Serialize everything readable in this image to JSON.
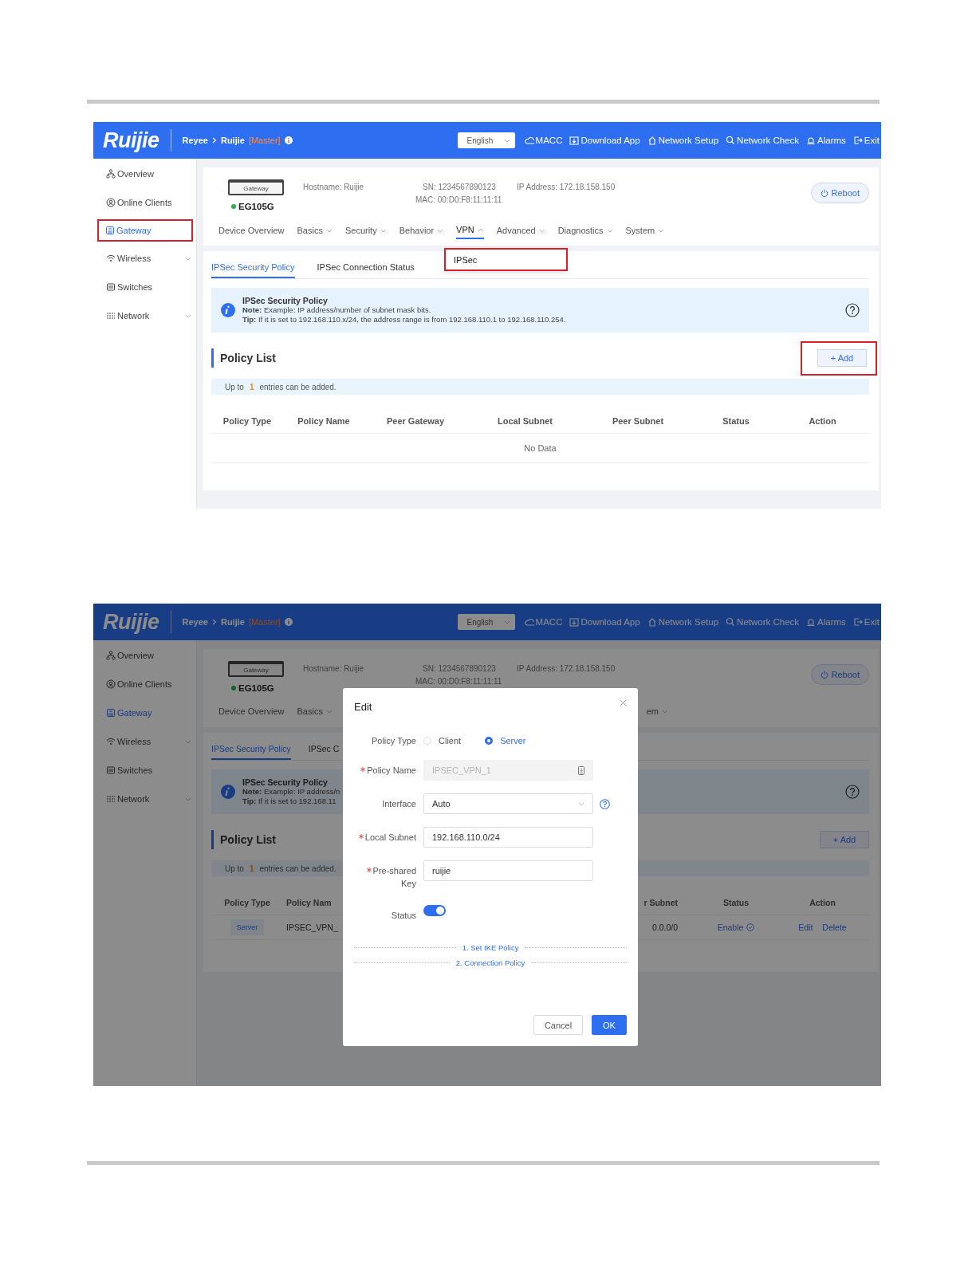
{
  "screens": [
    {
      "dimmed": false,
      "header": {
        "logo": "Ruijie",
        "breadcrumb": [
          "Reyee",
          "Ruijie"
        ],
        "role": "[Master]",
        "language": "English",
        "actions": [
          {
            "kind": "cloud",
            "label": "MACC"
          },
          {
            "kind": "download",
            "label": "Download App"
          },
          {
            "kind": "setup",
            "label": "Network Setup"
          },
          {
            "kind": "check",
            "label": "Network Check"
          },
          {
            "kind": "alarm",
            "label": "Alarms"
          },
          {
            "kind": "exit",
            "label": "Exit"
          }
        ]
      },
      "sidebar": [
        {
          "kind": "overview",
          "label": "Overview",
          "selected": false,
          "expandable": false,
          "annotated": false
        },
        {
          "kind": "clients",
          "label": "Online Clients",
          "selected": false,
          "expandable": false,
          "annotated": false
        },
        {
          "kind": "gateway",
          "label": "Gateway",
          "selected": true,
          "expandable": false,
          "annotated": true
        },
        {
          "kind": "wireless",
          "label": "Wireless",
          "selected": false,
          "expandable": true,
          "annotated": false
        },
        {
          "kind": "switches",
          "label": "Switches",
          "selected": false,
          "expandable": false,
          "annotated": false
        },
        {
          "kind": "network",
          "label": "Network",
          "selected": false,
          "expandable": true,
          "annotated": false
        }
      ],
      "device": {
        "icon_label": "Gateway",
        "model": "EG105G",
        "online": true,
        "hostname_label": "Hostname:",
        "hostname": "Ruijie",
        "sn_label": "SN:",
        "sn": "1234567890123",
        "mac_label": "MAC:",
        "mac": "00:D0:F8:11:11:11",
        "ip_label": "IP Address:",
        "ip": "172.18.158.150",
        "reboot": "Reboot"
      },
      "nav": [
        {
          "label": "Device Overview",
          "dropdown": false,
          "expanded": false,
          "selected": false
        },
        {
          "label": "Basics",
          "dropdown": true,
          "expanded": false,
          "selected": false
        },
        {
          "label": "Security",
          "dropdown": true,
          "expanded": false,
          "selected": false
        },
        {
          "label": "Behavior",
          "dropdown": true,
          "expanded": false,
          "selected": false
        },
        {
          "label": "VPN",
          "dropdown": true,
          "expanded": true,
          "selected": true
        },
        {
          "label": "Advanced",
          "dropdown": true,
          "expanded": false,
          "selected": false
        },
        {
          "label": "Diagnostics",
          "dropdown": true,
          "expanded": false,
          "selected": false
        },
        {
          "label": "System",
          "dropdown": true,
          "expanded": false,
          "selected": false
        }
      ],
      "submenu": {
        "items": [
          "IPSec"
        ],
        "annotated": true
      },
      "sub_tabs": [
        {
          "label": "IPSec Security Policy",
          "selected": true
        },
        {
          "label": "IPSec Connection Status",
          "selected": false
        }
      ],
      "info": {
        "title": "IPSec Security Policy",
        "note": "**Note:** Example: IP address/number of subnet mask bits.",
        "tip": "**Tip:** If it is set to 192.168.110.x/24, the address range is from 192.168.110.1 to 192.168.110.254."
      },
      "policy_list": {
        "title": "Policy List",
        "add": {
          "label": "+ Add",
          "annotated": true
        },
        "limit": {
          "prefix": "Up to",
          "count": "1",
          "suffix": "entries can be added."
        },
        "columns": [
          "Policy Type",
          "Policy Name",
          "Peer Gateway",
          "Local Subnet",
          "Peer Subnet",
          "Status",
          "Action"
        ],
        "empty": "No Data"
      }
    },
    {
      "dimmed": true,
      "header": {
        "logo": "Ruijie",
        "breadcrumb": [
          "Reyee",
          "Ruijie"
        ],
        "role": "[Master]",
        "language": "English",
        "actions": [
          {
            "kind": "cloud",
            "label": "MACC"
          },
          {
            "kind": "download",
            "label": "Download App"
          },
          {
            "kind": "setup",
            "label": "Network Setup"
          },
          {
            "kind": "check",
            "label": "Network Check"
          },
          {
            "kind": "alarm",
            "label": "Alarms"
          },
          {
            "kind": "exit",
            "label": "Exit"
          }
        ]
      },
      "sidebar": [
        {
          "kind": "overview",
          "label": "Overview",
          "selected": false,
          "expandable": false,
          "annotated": false
        },
        {
          "kind": "clients",
          "label": "Online Clients",
          "selected": false,
          "expandable": false,
          "annotated": false
        },
        {
          "kind": "gateway",
          "label": "Gateway",
          "selected": true,
          "expandable": false,
          "annotated": false
        },
        {
          "kind": "wireless",
          "label": "Wireless",
          "selected": false,
          "expandable": true,
          "annotated": false
        },
        {
          "kind": "switches",
          "label": "Switches",
          "selected": false,
          "expandable": false,
          "annotated": false
        },
        {
          "kind": "network",
          "label": "Network",
          "selected": false,
          "expandable": true,
          "annotated": false
        }
      ],
      "device": {
        "icon_label": "Gateway",
        "model": "EG105G",
        "online": true,
        "hostname_label": "Hostname:",
        "hostname": "Ruijie",
        "sn_label": "SN:",
        "sn": "1234567890123",
        "mac_label": "MAC:",
        "mac": "00:D0:F8:11:11:11",
        "ip_label": "IP Address:",
        "ip": "172.18.158.150",
        "reboot": "Reboot"
      },
      "nav": [
        {
          "label": "Device Overview",
          "dropdown": false,
          "expanded": false,
          "selected": false
        },
        {
          "label": "Basics",
          "dropdown": true,
          "expanded": false,
          "selected": false
        }
      ],
      "nav_right": [
        {
          "label": "em",
          "dropdown": true,
          "expanded": false,
          "selected": false
        }
      ],
      "sub_tabs": [
        {
          "label": "IPSec Security Policy",
          "selected": true
        },
        {
          "label": "IPSec C",
          "selected": false
        }
      ],
      "info": {
        "title": "IPSec Security Policy",
        "note": "**Note:** Example: IP address/n",
        "tip": "**Tip:** If it is set to 192.168.11"
      },
      "policy_list": {
        "title": "Policy List",
        "add": {
          "label": "+ Add",
          "annotated": false
        },
        "limit": {
          "prefix": "Up to",
          "count": "1",
          "suffix": "entries can be added."
        },
        "columns": [
          "Policy Type",
          "Policy Nam"
        ],
        "columns_right": [
          "r Subnet",
          "Status",
          "Action"
        ],
        "rows": [
          {
            "cells": [
              {
                "kind": "tag",
                "text": "Server"
              },
              {
                "kind": "text",
                "text": "IPSEC_VPN_"
              }
            ],
            "cells_right": [
              {
                "kind": "text",
                "text": "0.0.0/0"
              },
              {
                "kind": "status",
                "text": "Enable"
              },
              {
                "kind": "actions",
                "links": [
                  "Edit",
                  "Delete"
                ]
              }
            ]
          }
        ]
      },
      "dialog": {
        "title": "Edit",
        "fields": [
          {
            "kind": "radio",
            "label": "Policy Type",
            "required": false,
            "options": [
              {
                "label": "Client",
                "selected": false
              },
              {
                "label": "Server",
                "selected": true
              }
            ]
          },
          {
            "kind": "input",
            "label": "Policy Name",
            "required": true,
            "value": "IPSEC_VPN_1",
            "disabled": true
          },
          {
            "kind": "select",
            "label": "Interface",
            "required": false,
            "value": "Auto"
          },
          {
            "kind": "input",
            "label": "Local Subnet",
            "required": true,
            "value": "192.168.110.0/24",
            "disabled": false
          },
          {
            "kind": "input",
            "label": "Pre-shared Key",
            "required": true,
            "value": "ruijie",
            "disabled": false
          },
          {
            "kind": "toggle",
            "label": "Status",
            "required": false,
            "on": true
          }
        ],
        "sections": [
          "1. Set IKE Policy",
          "2. Connection Policy"
        ],
        "buttons": [
          {
            "kind": "secondary",
            "label": "Cancel"
          },
          {
            "kind": "primary",
            "label": "OK"
          }
        ]
      }
    }
  ]
}
